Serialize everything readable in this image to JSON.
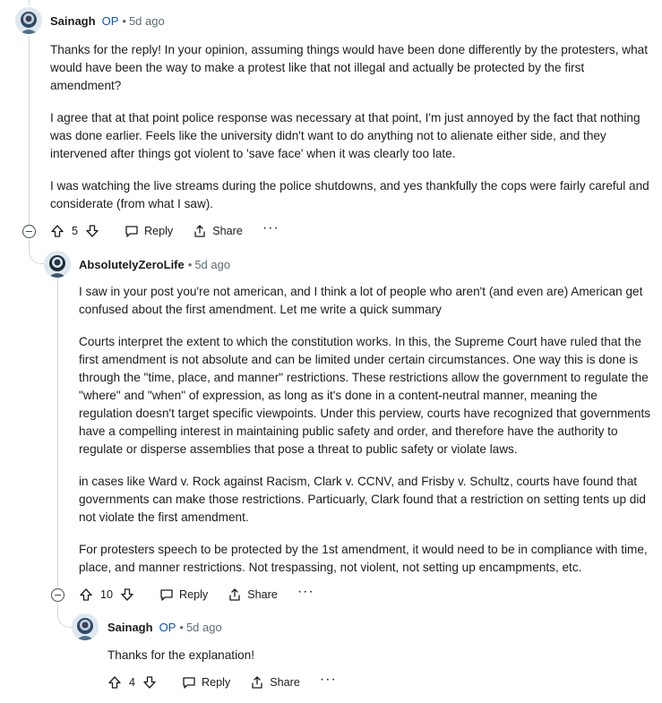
{
  "comments": [
    {
      "author": "Sainagh",
      "op_badge": "OP",
      "separator": "•",
      "age": "5d ago",
      "paragraphs": [
        "Thanks for the reply! In your opinion, assuming things would have been done differently by the protesters, what would have been the way to make a protest like that not illegal and actually be protected by the first amendment?",
        "I agree that at that point police response was necessary at that point, I'm just annoyed by the fact that nothing was done earlier. Feels like the university didn't want to do anything not to alienate either side, and they intervened after things got violent to 'save face' when it was clearly too late.",
        "I was watching the live streams during the police shutdowns, and yes thankfully the cops were fairly careful and considerate (from what I saw)."
      ],
      "votes": "5",
      "reply_label": "Reply",
      "share_label": "Share",
      "more_label": "···"
    },
    {
      "author": "AbsolutelyZeroLife",
      "separator": "•",
      "age": "5d ago",
      "paragraphs": [
        "I saw in your post you're not american, and I think a lot of people who aren't (and even are) American get confused about the first amendment. Let me write a quick summary",
        "Courts interpret the extent to which the constitution works. In this, the Supreme Court have ruled that the first amendment is not absolute and can be limited under certain circumstances. One way this is done is through the \"time, place, and manner\" restrictions. These restrictions allow the government to regulate the \"where\" and \"when\" of expression, as long as it's done in a content-neutral manner, meaning the regulation doesn't target specific viewpoints. Under this perview, courts have recognized that governments have a compelling interest in maintaining public safety and order, and therefore have the authority to regulate or disperse assemblies that pose a threat to public safety or violate laws.",
        "in cases like Ward v. Rock against Racism, Clark v. CCNV, and Frisby v. Schultz, courts have found that governments can make those restrictions. Particuarly, Clark found that a restriction on setting tents up did not violate the first amendment.",
        "For protesters speech to be protected by the 1st amendment, it would need to be in compliance with time, place, and manner restrictions. Not trespassing, not violent, not setting up encampments, etc."
      ],
      "votes": "10",
      "reply_label": "Reply",
      "share_label": "Share",
      "more_label": "···"
    },
    {
      "author": "Sainagh",
      "op_badge": "OP",
      "separator": "•",
      "age": "5d ago",
      "paragraphs": [
        "Thanks for the explanation!"
      ],
      "votes": "4",
      "reply_label": "Reply",
      "share_label": "Share",
      "more_label": "···"
    }
  ],
  "icons": {
    "upvote": "upvote-icon",
    "downvote": "downvote-icon",
    "reply": "reply-icon",
    "share": "share-icon",
    "collapse": "collapse-icon"
  },
  "colors": {
    "op_badge": "#0a56c2",
    "muted_text": "#5c6c74",
    "thread_line": "#d4d8db"
  }
}
